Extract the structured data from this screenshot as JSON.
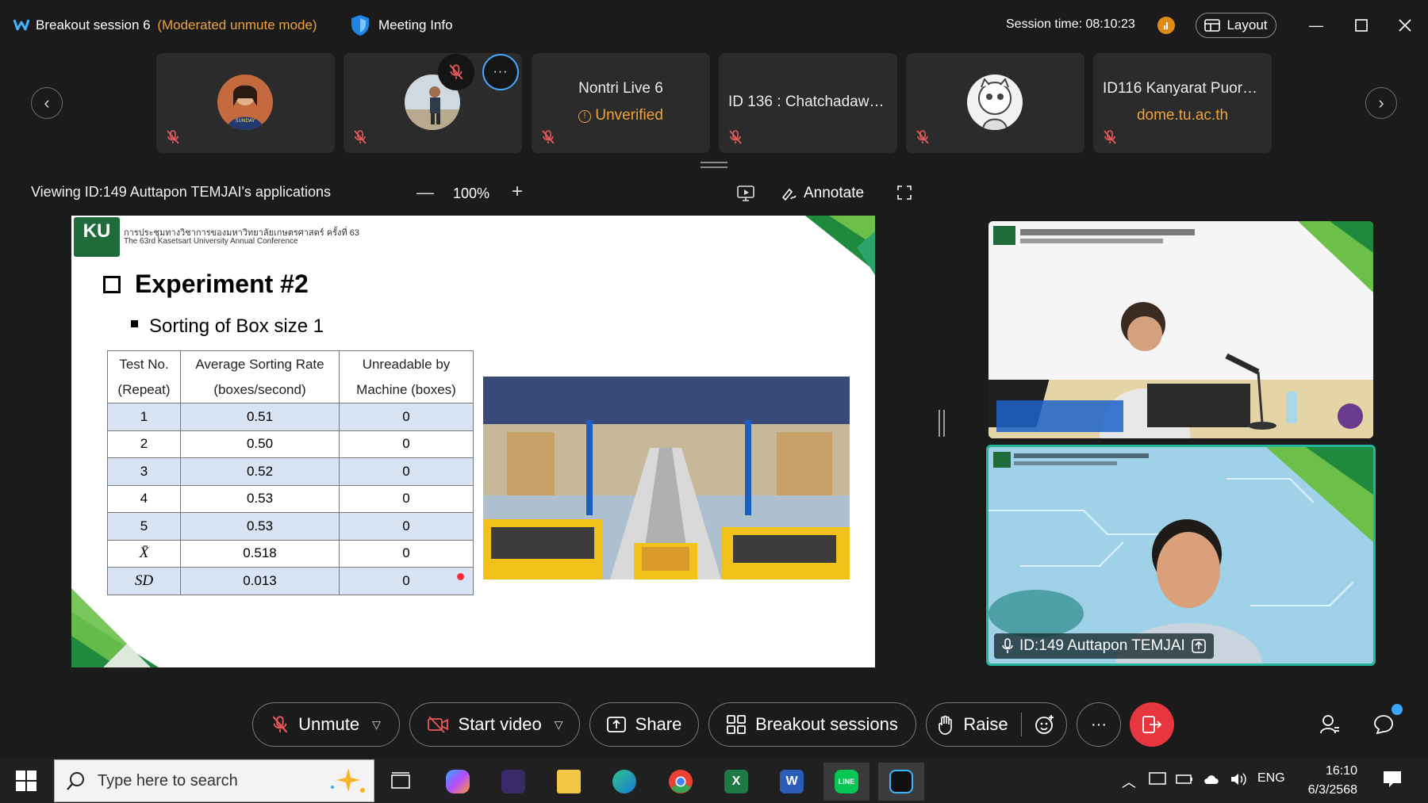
{
  "titlebar": {
    "title": "Breakout session 6",
    "mode": "(Moderated unmute mode)",
    "meeting_info": "Meeting Info",
    "session_time": "Session time: 08:10:23",
    "layout": "Layout"
  },
  "participants": [
    {
      "kind": "avatar"
    },
    {
      "kind": "avatar"
    },
    {
      "name": "Nontri Live 6",
      "sub": "Unverified"
    },
    {
      "name": "ID 136 : Chatchadawa..."
    },
    {
      "kind": "avatar"
    },
    {
      "name": "ID116 Kanyarat Puora...",
      "sub": "dome.tu.ac.th"
    }
  ],
  "viewing": {
    "text": "Viewing ID:149 Auttapon TEMJAI's applications",
    "zoom": "100%",
    "annotate": "Annotate"
  },
  "slide": {
    "logo": "KU",
    "conf_line1": "การประชุมทางวิชาการของมหาวิทยาลัยเกษตรศาสตร์ ครั้งที่ 63",
    "conf_line2": "The 63rd Kasetsart University Annual Conference",
    "title": "Experiment #2",
    "subtitle": "Sorting of Box size 1",
    "table": {
      "headers": [
        [
          "Test No.",
          "(Repeat)"
        ],
        [
          "Average Sorting Rate",
          "(boxes/second)"
        ],
        [
          "Unreadable by",
          "Machine (boxes)"
        ]
      ],
      "rows": [
        [
          "1",
          "0.51",
          "0"
        ],
        [
          "2",
          "0.50",
          "0"
        ],
        [
          "3",
          "0.52",
          "0"
        ],
        [
          "4",
          "0.53",
          "0"
        ],
        [
          "5",
          "0.53",
          "0"
        ],
        [
          "X̄",
          "0.518",
          "0"
        ],
        [
          "SD",
          "0.013",
          "0"
        ]
      ]
    }
  },
  "videos": {
    "speaker_label": "ID:149 Auttapon TEMJAI"
  },
  "toolbar": {
    "unmute": "Unmute",
    "start_video": "Start video",
    "share": "Share",
    "breakout": "Breakout sessions",
    "raise": "Raise",
    "more": "···"
  },
  "taskbar": {
    "search_placeholder": "Type here to search",
    "lang": "ENG",
    "time": "16:10",
    "date": "6/3/2568"
  },
  "colors": {
    "accent_orange": "#f0a23a",
    "leave_red": "#e8363f",
    "speaker_border": "#25b59b",
    "table_shade": "#d8e3f3"
  }
}
